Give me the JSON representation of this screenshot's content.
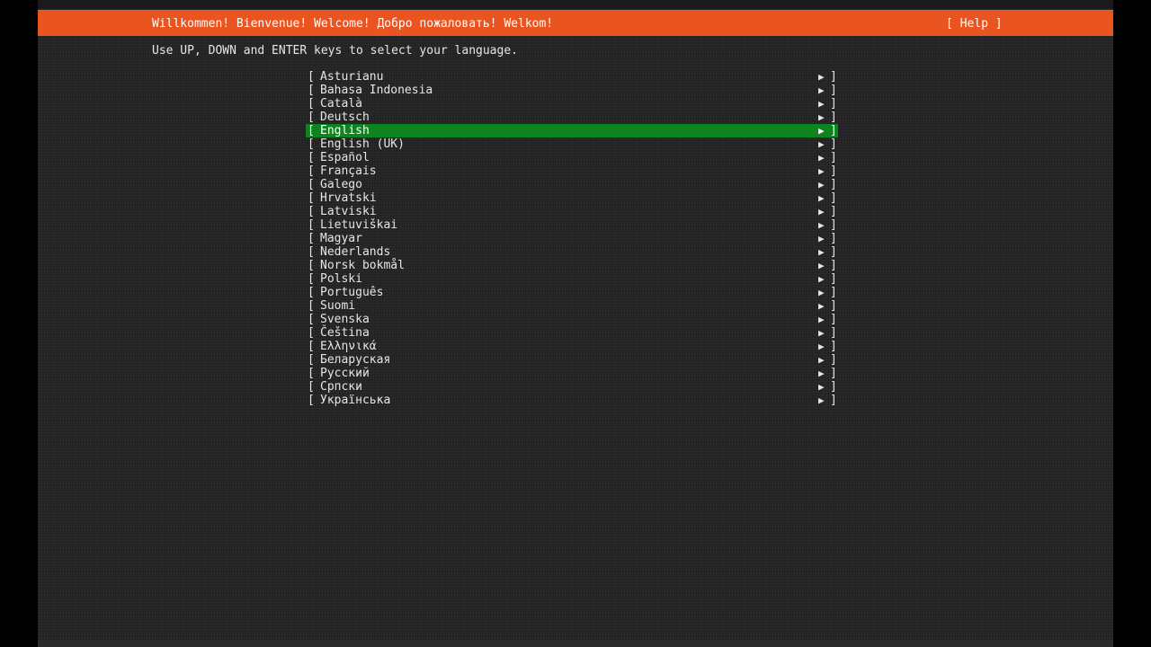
{
  "header": {
    "title": "Willkommen! Bienvenue! Welcome! Добро пожаловать! Welkom!",
    "help_label": "[ Help ]"
  },
  "instructions": "Use UP, DOWN and ENTER keys to select your language.",
  "list": {
    "open_bracket": "[",
    "close_bracket": "]",
    "arrow": "▶"
  },
  "languages": [
    {
      "label": "Asturianu"
    },
    {
      "label": "Bahasa Indonesia"
    },
    {
      "label": "Català"
    },
    {
      "label": "Deutsch"
    },
    {
      "label": "English",
      "selected": true
    },
    {
      "label": "English (UK)"
    },
    {
      "label": "Español"
    },
    {
      "label": "Français"
    },
    {
      "label": "Galego"
    },
    {
      "label": "Hrvatski"
    },
    {
      "label": "Latviski"
    },
    {
      "label": "Lietuviškai"
    },
    {
      "label": "Magyar"
    },
    {
      "label": "Nederlands"
    },
    {
      "label": "Norsk bokmål"
    },
    {
      "label": "Polski"
    },
    {
      "label": "Português"
    },
    {
      "label": "Suomi"
    },
    {
      "label": "Svenska"
    },
    {
      "label": "Čeština"
    },
    {
      "label": "Ελληνικά"
    },
    {
      "label": "Беларуская"
    },
    {
      "label": "Русский"
    },
    {
      "label": "Српски"
    },
    {
      "label": "Українська"
    }
  ],
  "colors": {
    "header_bg": "#e95420",
    "selection_bg": "#0e8420",
    "terminal_bg": "#222222"
  }
}
